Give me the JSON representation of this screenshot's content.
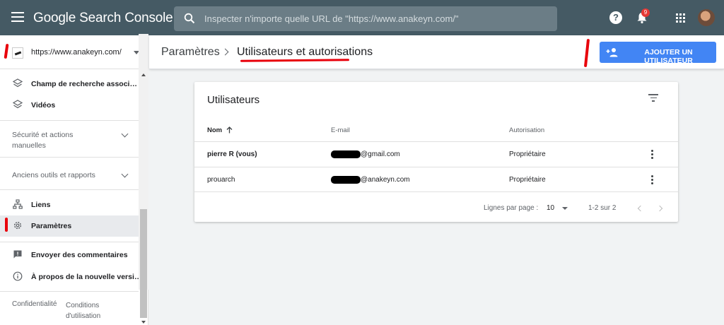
{
  "topbar": {
    "app_name": "Google Search Console",
    "search_placeholder": "Inspecter n'importe quelle URL de \"https://www.anakeyn.com/\"",
    "notification_count": "9",
    "help_label": "?",
    "color": "#455a64"
  },
  "sidebar": {
    "property": "https://www.anakeyn.com/",
    "items_top": [
      {
        "label": "Champ de recherche associ…",
        "icon": "layers-icon"
      },
      {
        "label": "Vidéos",
        "icon": "layers-icon"
      }
    ],
    "sections": [
      {
        "label": "Sécurité et actions manuelles"
      },
      {
        "label": "Anciens outils et rapports"
      }
    ],
    "items_mid": [
      {
        "label": "Liens",
        "icon": "sitemap-icon"
      },
      {
        "label": "Paramètres",
        "icon": "gear-icon",
        "active": true
      }
    ],
    "items_bottom": [
      {
        "label": "Envoyer des commentaires",
        "icon": "feedback-icon"
      },
      {
        "label": "À propos de la nouvelle versi…",
        "icon": "info-icon"
      }
    ],
    "footer": {
      "privacy": "Confidentialité",
      "terms": "Conditions d'utilisation"
    }
  },
  "header": {
    "breadcrumb_parent": "Paramètres",
    "breadcrumb_current": "Utilisateurs et autorisations",
    "add_user_label": "AJOUTER UN UTILISATEUR",
    "accent": "#4285f4"
  },
  "users_card": {
    "title": "Utilisateurs",
    "columns": {
      "name": "Nom",
      "email": "E-mail",
      "permission": "Autorisation"
    },
    "rows": [
      {
        "name": "pierre R (vous)",
        "email": "@gmail.com",
        "permission": "Propriétaire",
        "bold": true
      },
      {
        "name": "prouarch",
        "email": "@anakeyn.com",
        "permission": "Propriétaire",
        "bold": false
      }
    ],
    "pagination": {
      "rows_per_page_label": "Lignes par page :",
      "rows_per_page": "10",
      "range": "1-2 sur 2"
    }
  },
  "annotation_color": "#e8000b"
}
